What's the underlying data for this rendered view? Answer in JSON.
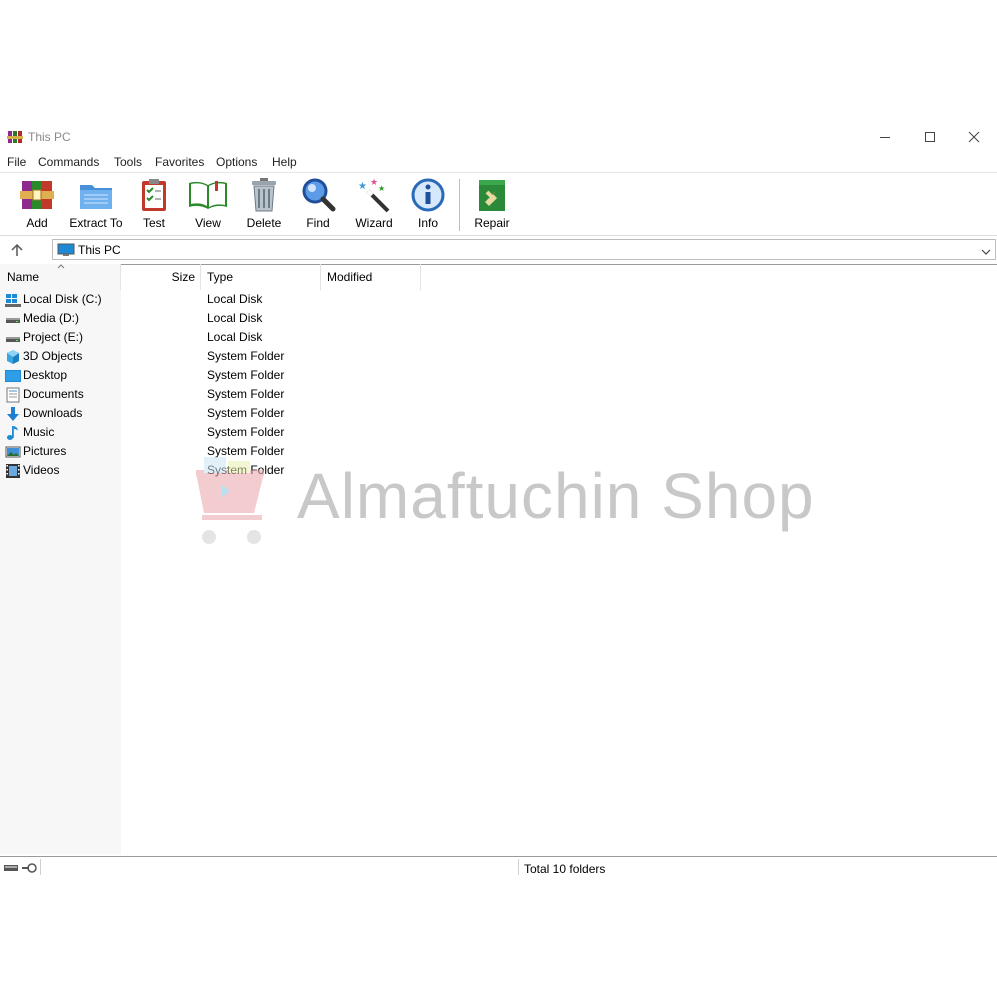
{
  "window": {
    "title": "This PC",
    "controls": [
      "minimize",
      "maximize",
      "close"
    ]
  },
  "menu": [
    "File",
    "Commands",
    "Tools",
    "Favorites",
    "Options",
    "Help"
  ],
  "toolbar": {
    "buttons": [
      {
        "label": "Add",
        "icon": "add-archive-icon"
      },
      {
        "label": "Extract To",
        "icon": "extract-folder-icon"
      },
      {
        "label": "Test",
        "icon": "test-clipboard-icon"
      },
      {
        "label": "View",
        "icon": "view-book-icon"
      },
      {
        "label": "Delete",
        "icon": "trash-icon"
      },
      {
        "label": "Find",
        "icon": "magnifier-icon"
      },
      {
        "label": "Wizard",
        "icon": "magic-wand-icon"
      },
      {
        "label": "Info",
        "icon": "info-icon"
      },
      {
        "label": "Repair",
        "icon": "repair-kit-icon"
      }
    ]
  },
  "address": {
    "path": "This PC"
  },
  "columns": {
    "name": "Name",
    "size": "Size",
    "type": "Type",
    "modified": "Modified"
  },
  "files": [
    {
      "name": "Local Disk (C:)",
      "type": "Local Disk",
      "icon": "windows-drive-icon"
    },
    {
      "name": "Media (D:)",
      "type": "Local Disk",
      "icon": "drive-icon"
    },
    {
      "name": "Project (E:)",
      "type": "Local Disk",
      "icon": "drive-icon"
    },
    {
      "name": "3D Objects",
      "type": "System Folder",
      "icon": "cube-icon"
    },
    {
      "name": "Desktop",
      "type": "System Folder",
      "icon": "desktop-icon"
    },
    {
      "name": "Documents",
      "type": "System Folder",
      "icon": "document-icon"
    },
    {
      "name": "Downloads",
      "type": "System Folder",
      "icon": "download-arrow-icon"
    },
    {
      "name": "Music",
      "type": "System Folder",
      "icon": "music-note-icon"
    },
    {
      "name": "Pictures",
      "type": "System Folder",
      "icon": "picture-icon"
    },
    {
      "name": "Videos",
      "type": "System Folder",
      "icon": "film-icon"
    }
  ],
  "status": {
    "text": "Total 10 folders"
  },
  "watermark": {
    "text": "Almaftuchin Shop"
  },
  "colors": {
    "accent": "#2e8fd6",
    "watermark": "#c8c8c8",
    "name_column_bg": "#f7f7f7"
  }
}
